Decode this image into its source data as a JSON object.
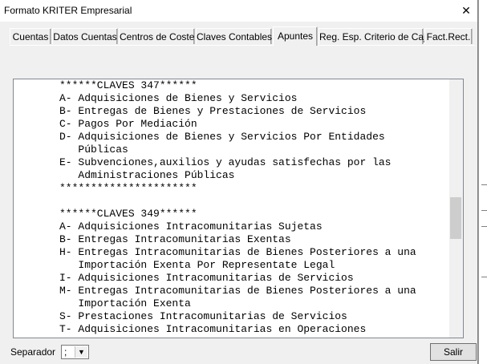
{
  "window": {
    "title": "Formato KRITER Empresarial",
    "close_icon": "close-icon"
  },
  "tabs": [
    {
      "label": "Cuentas",
      "active": false
    },
    {
      "label": "Datos Cuentas",
      "active": false
    },
    {
      "label": "Centros de Coste",
      "active": false
    },
    {
      "label": "Claves Contables",
      "active": false
    },
    {
      "label": "Apuntes",
      "active": true
    },
    {
      "label": "Reg. Esp. Criterio de Caja",
      "active": false
    },
    {
      "label": "Fact.Rect.",
      "active": false
    }
  ],
  "content": {
    "lines": [
      "******CLAVES 347******",
      "A- Adquisiciones de Bienes y Servicios",
      "B- Entregas de Bienes y Prestaciones de Servicios",
      "C- Pagos Por Mediación",
      "D- Adquisiciones de Bienes y Servicios Por Entidades",
      "   Públicas",
      "E- Subvenciones,auxilios y ayudas satisfechas por las",
      "   Administraciones Públicas",
      "**********************",
      "",
      "******CLAVES 349******",
      "A- Adquisiciones Intracomunitarias Sujetas",
      "B- Entregas Intracomunitarias Exentas",
      "H- Entregas Intracomunitarias de Bienes Posteriores a una",
      "   Importación Exenta Por Representate Legal",
      "I- Adquisiciones Intracomunitarias de Servicios",
      "M- Entregas Intracomunitarias de Bienes Posteriores a una",
      "   Importación Exenta",
      "S- Prestaciones Intracomunitarias de Servicios",
      "T- Adquisiciones Intracomunitarias en Operaciones"
    ]
  },
  "bottom": {
    "separator_label": "Separador",
    "separator_value": ";",
    "exit_label": "Salir"
  }
}
